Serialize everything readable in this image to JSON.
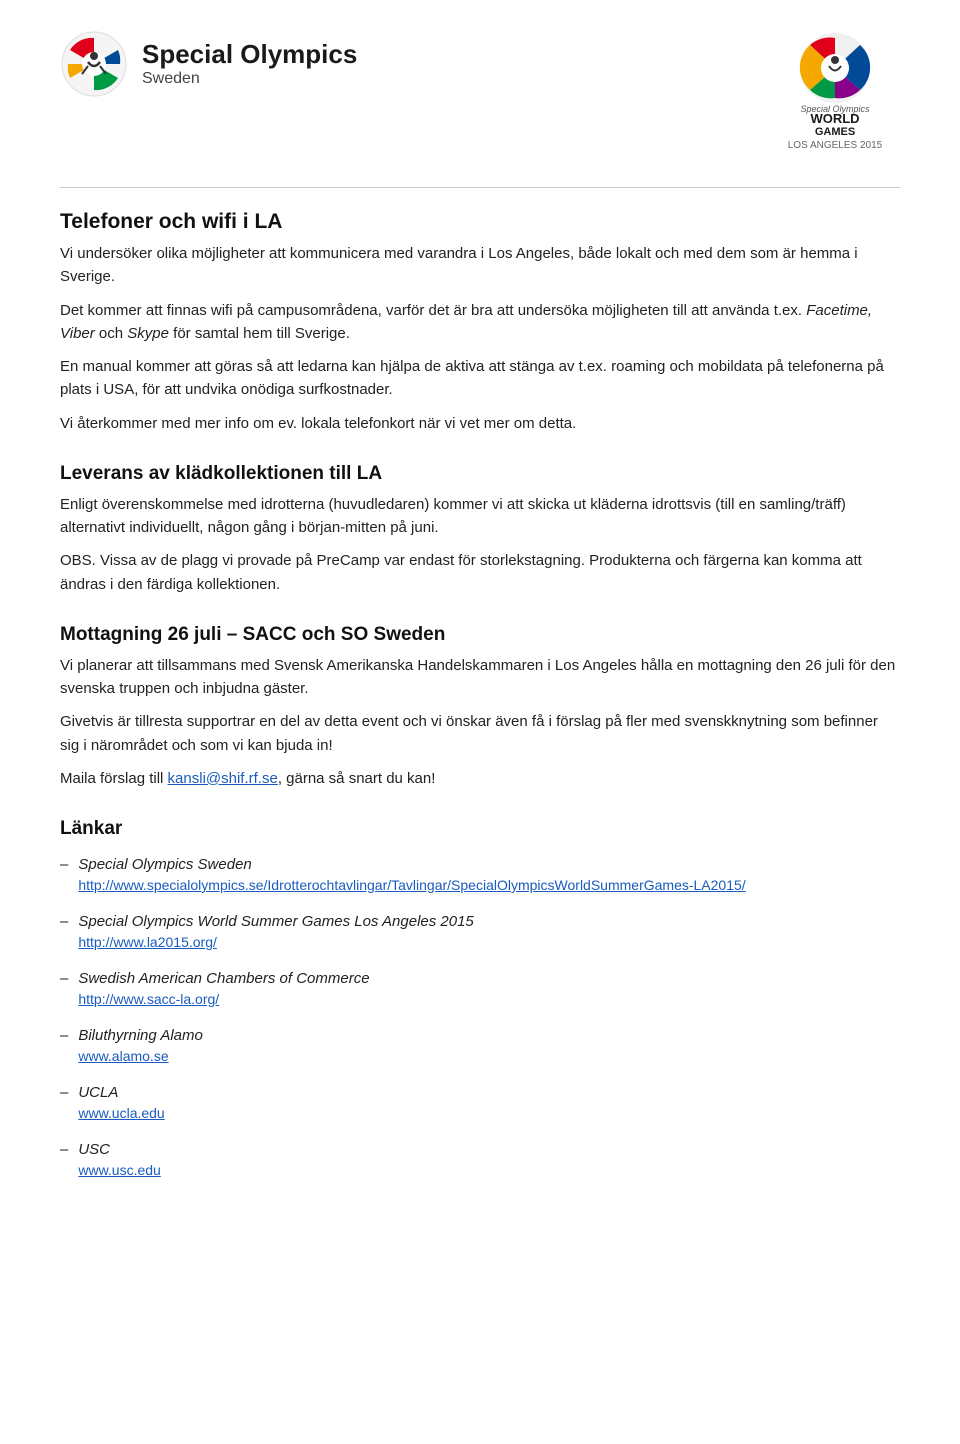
{
  "header": {
    "logo_title": "Special Olympics",
    "logo_subtitle": "Sweden"
  },
  "sections": [
    {
      "heading": "Telefoner och wifi i LA",
      "level": 1,
      "paragraphs": [
        "Vi undersöker olika möjligheter att kommunicera med varandra i Los Angeles, både lokalt och med dem som är hemma i Sverige.",
        "Det kommer att finnas wifi på campusområdena, varför det är bra att undersöka möjligheten till att använda t.ex. <em>Facetime, Viber</em> och <em>Skype</em> för samtal hem till Sverige.",
        "En manual kommer att göras så att ledarna kan hjälpa de aktiva att stänga av t.ex. roaming och mobildata på telefonerna på plats i USA, för att undvika onödiga surfkostnader.",
        "Vi återkommer med mer info om ev. lokala telefonkort när vi vet mer om detta."
      ]
    },
    {
      "heading": "Leverans av klädkollektionen till LA",
      "level": 2,
      "paragraphs": [
        "Enligt överenskommelse med idrotterna (huvudledaren) kommer vi att skicka ut kläderna idrottsvis (till en samling/träff) alternativt individuellt, någon gång i början-mitten på juni.",
        "OBS. Vissa av de plagg vi provade på PreCamp var endast för storlekstagning. Produkterna och färgerna kan komma att ändras i den färdiga kollektionen."
      ]
    },
    {
      "heading": "Mottagning 26 juli – SACC och SO Sweden",
      "level": 2,
      "paragraphs": [
        "Vi planerar att tillsammans med Svensk Amerikanska Handelskammaren i Los Angeles hålla en mottagning den 26 juli för den svenska truppen och inbjudna gäster.",
        "Givetvis är tillresta supportrar en del av detta event och vi önskar även få i förslag på fler med svenskknytning som befinner sig i närområdet och som vi kan bjuda in!",
        "Maila förslag till <a href=\"mailto:kansli@shif.rf.se\">kansli@shif.rf.se</a>, gärna så snart du kan!"
      ]
    }
  ],
  "links": {
    "heading": "Länkar",
    "items": [
      {
        "label": "Special Olympics Sweden",
        "url": "http://www.specialolympics.se/Idrotterochtavlingar/Tavlingar/SpecialOlympicsWorldSummerGames-LA2015/"
      },
      {
        "label": "Special Olympics World Summer Games Los Angeles 2015",
        "url": "http://www.la2015.org/"
      },
      {
        "label": "Swedish American Chambers of Commerce",
        "url": "http://www.sacc-la.org/"
      },
      {
        "label": "Biluthyrning Alamo",
        "url": "www.alamo.se"
      },
      {
        "label": "UCLA",
        "url": "www.ucla.edu"
      },
      {
        "label": "USC",
        "url": "www.usc.edu"
      }
    ]
  }
}
